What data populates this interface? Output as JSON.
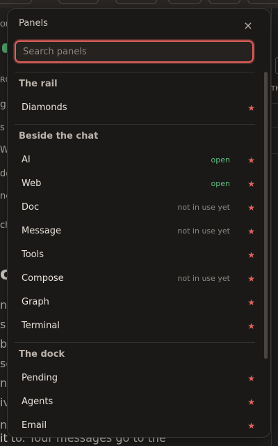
{
  "panel": {
    "title": "Panels",
    "close_label": "×",
    "search": {
      "placeholder": "Search panels",
      "value": ""
    }
  },
  "sections": [
    {
      "title": "The rail",
      "items": [
        {
          "label": "Diamonds",
          "status": "",
          "favorite": true
        }
      ]
    },
    {
      "title": "Beside the chat",
      "items": [
        {
          "label": "AI",
          "status": "open",
          "favorite": true
        },
        {
          "label": "Web",
          "status": "open",
          "favorite": true
        },
        {
          "label": "Doc",
          "status": "not in use yet",
          "favorite": true
        },
        {
          "label": "Message",
          "status": "not in use yet",
          "favorite": true
        },
        {
          "label": "Tools",
          "status": "",
          "favorite": true
        },
        {
          "label": "Compose",
          "status": "not in use yet",
          "favorite": true
        },
        {
          "label": "Graph",
          "status": "",
          "favorite": true
        },
        {
          "label": "Terminal",
          "status": "",
          "favorite": true
        }
      ]
    },
    {
      "title": "The dock",
      "items": [
        {
          "label": "Pending",
          "status": "",
          "favorite": true
        },
        {
          "label": "Agents",
          "status": "",
          "favorite": true
        },
        {
          "label": "Email",
          "status": "",
          "favorite": true
        },
        {
          "label": "Work",
          "status": "",
          "favorite": true
        }
      ]
    }
  ],
  "star_glyph": "★",
  "background": {
    "fragments": [
      "ON",
      "ROON",
      "g",
      "s",
      "W",
      "de",
      "ne",
      "ch"
    ],
    "big_text": "ct",
    "left_lines": [
      "no",
      "s",
      "b",
      "se",
      "nl",
      "iv",
      "ng"
    ],
    "bottom_text": "it to. Your messages go to the",
    "right_label": "TH"
  },
  "colors": {
    "accent": "#e2615c",
    "open_status": "#5fbf81",
    "panel_bg": "#1b1918"
  }
}
